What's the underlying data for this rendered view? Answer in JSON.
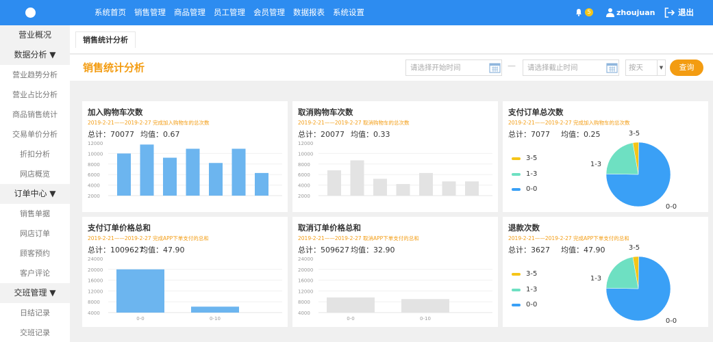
{
  "nav": {
    "items": [
      "系统首页",
      "销售管理",
      "商品管理",
      "员工管理",
      "会员管理",
      "数据报表",
      "系统设置"
    ],
    "badge_count": "5",
    "username": "zhoujuan",
    "logout": "退出"
  },
  "sidebar": {
    "items": [
      {
        "label": "营业概况",
        "kind": "top"
      },
      {
        "label": "数据分析 ▼",
        "kind": "head"
      },
      {
        "label": "营业趋势分析",
        "kind": "sub"
      },
      {
        "label": "营业占比分析",
        "kind": "sub"
      },
      {
        "label": "商品销售统计",
        "kind": "sub"
      },
      {
        "label": "交易单价分析",
        "kind": "sub"
      },
      {
        "label": "折扣分析",
        "kind": "sub"
      },
      {
        "label": "网店概览",
        "kind": "sub"
      },
      {
        "label": "订单中心 ▼",
        "kind": "head"
      },
      {
        "label": "销售单据",
        "kind": "sub"
      },
      {
        "label": "网店订单",
        "kind": "sub"
      },
      {
        "label": "顾客预约",
        "kind": "sub"
      },
      {
        "label": "客户评论",
        "kind": "sub"
      },
      {
        "label": "交班管理 ▼",
        "kind": "head"
      },
      {
        "label": "日结记录",
        "kind": "sub"
      },
      {
        "label": "交班记录",
        "kind": "sub"
      }
    ]
  },
  "tab": {
    "label": "销售统计分析"
  },
  "header": {
    "title": "销售统计分析",
    "start_placeholder": "请选择开始时间",
    "end_placeholder": "请选择截止时间",
    "dash": "—",
    "period_select": "按天",
    "query_button": "查询"
  },
  "colors": {
    "accent": "#2d8cf0",
    "orange": "#f39c12",
    "bar_blue": "#6cb5ef",
    "bar_gray": "#e3e3e3",
    "pie_blue": "#3aa0f6",
    "pie_teal": "#6ee0c2",
    "pie_yellow": "#f5c518"
  },
  "panels": [
    {
      "title": "加入购物车次数",
      "subtitle": "2019-2-21——2019-2-27 完成加入购物车的总次数",
      "total": "总计：70077",
      "avg": "均值：0.67",
      "chart_data": {
        "type": "bar",
        "color": "blue",
        "yticks": [
          "12000",
          "10000",
          "8000",
          "6000",
          "4000",
          "2000"
        ],
        "ylim": [
          2000,
          12000
        ],
        "values": [
          10000,
          11700,
          9200,
          10900,
          8200,
          10900,
          6300
        ],
        "categories": []
      }
    },
    {
      "title": "取消购物车次数",
      "subtitle": "2019-2-21——2019-2-27 取消购物车的总次数",
      "total": "总计：20077",
      "avg": "均值：0.33",
      "chart_data": {
        "type": "bar",
        "color": "gray",
        "yticks": [
          "12000",
          "10000",
          "8000",
          "6000",
          "4000",
          "2000"
        ],
        "ylim": [
          2000,
          12000
        ],
        "values": [
          6800,
          8700,
          5200,
          4200,
          6300,
          4700,
          4700
        ],
        "categories": []
      }
    },
    {
      "title": "支付订单总次数",
      "subtitle": "2019-2-21——2019-2-27 完成加入购物车的总次数",
      "total": "总计：7077",
      "avg": "均值：0.25",
      "chart_data": {
        "type": "pie",
        "slices": [
          {
            "name": "3-5",
            "value": 3,
            "color": "yellow"
          },
          {
            "name": "1-3",
            "value": 22,
            "color": "teal"
          },
          {
            "name": "0-0",
            "value": 75,
            "color": "blue"
          }
        ]
      }
    },
    {
      "title": "支付订单价格总和",
      "subtitle": "2019-2-21——2019-2-27 完成APP下单支付的总和",
      "total": "总计：1009627",
      "avg": "均值：47.90",
      "chart_data": {
        "type": "bar",
        "color": "blue",
        "yticks": [
          "24000",
          "20000",
          "16000",
          "12000",
          "8000",
          "4000"
        ],
        "ylim": [
          4000,
          24000
        ],
        "values": [
          20000,
          6200
        ],
        "categories": [
          "0-0",
          "0-10"
        ]
      }
    },
    {
      "title": "取消订单价格总和",
      "subtitle": "2019-2-21——2019-2-27 取消APP下单支付的总和",
      "total": "总计：509627",
      "avg": "均值：32.90",
      "chart_data": {
        "type": "bar",
        "color": "gray",
        "yticks": [
          "24000",
          "20000",
          "16000",
          "12000",
          "8000",
          "4000"
        ],
        "ylim": [
          4000,
          24000
        ],
        "values": [
          9600,
          9000
        ],
        "categories": [
          "0-0",
          "0-10"
        ]
      }
    },
    {
      "title": "退款次数",
      "subtitle": "2019-2-21——2019-2-27 完成APP下单支付的总和",
      "total": "总计：3627",
      "avg": "均值：47.90",
      "chart_data": {
        "type": "pie",
        "slices": [
          {
            "name": "3-5",
            "value": 3,
            "color": "yellow"
          },
          {
            "name": "1-3",
            "value": 22,
            "color": "teal"
          },
          {
            "name": "0-0",
            "value": 75,
            "color": "blue"
          }
        ]
      }
    }
  ]
}
